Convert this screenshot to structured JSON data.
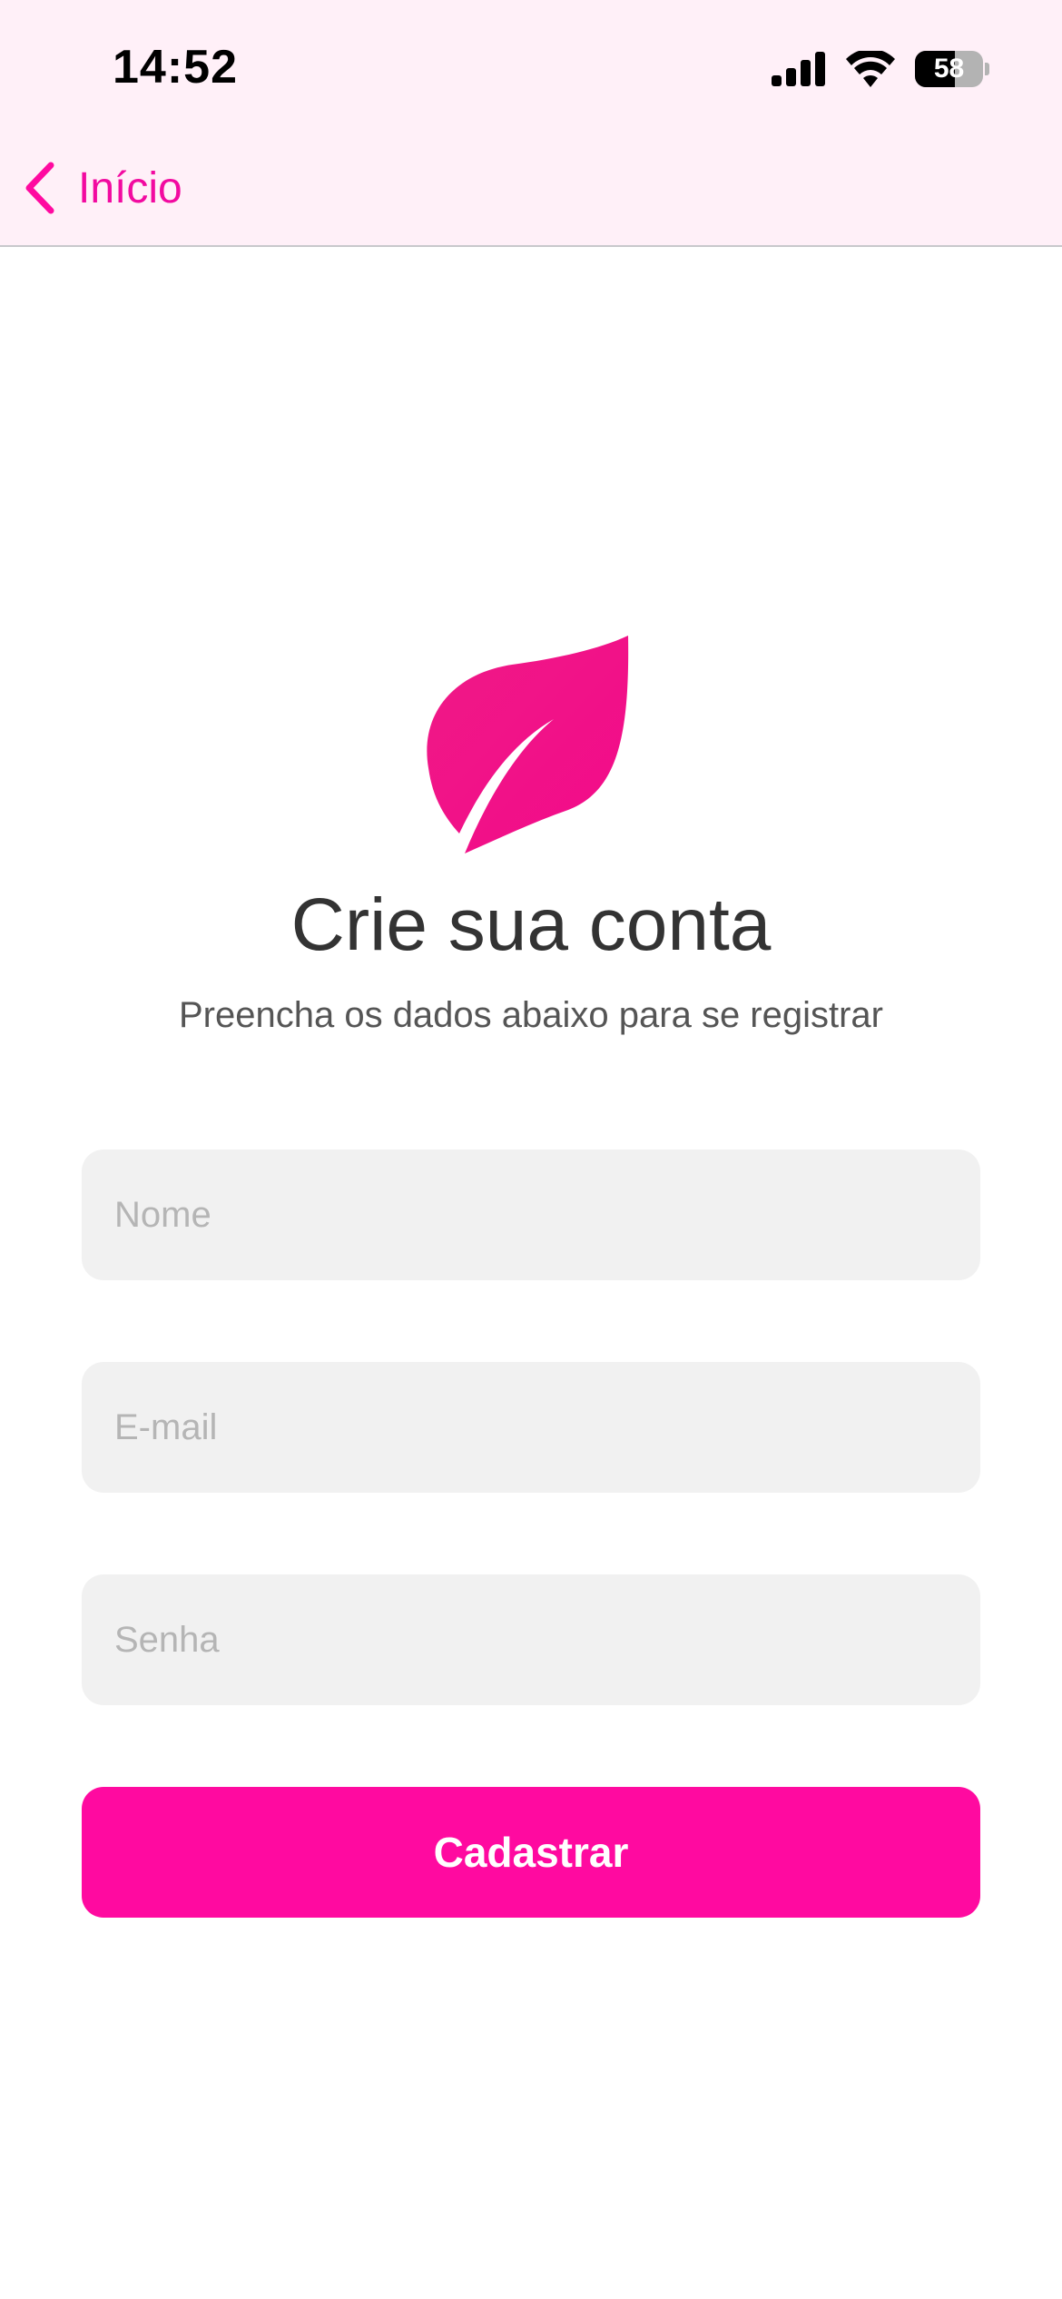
{
  "status_bar": {
    "time": "14:52",
    "battery_level": "58",
    "icons": [
      "signal-icon",
      "wifi-icon",
      "battery-icon"
    ]
  },
  "nav": {
    "back_label": "Início",
    "back_icon": "chevron-left-icon"
  },
  "header": {
    "logo_icon": "leaf-icon",
    "title": "Crie sua conta",
    "subtitle": "Preencha os dados abaixo para se registrar"
  },
  "form": {
    "name_placeholder": "Nome",
    "name_value": "",
    "email_placeholder": "E-mail",
    "email_value": "",
    "password_placeholder": "Senha",
    "password_value": "",
    "submit_label": "Cadastrar"
  },
  "colors": {
    "accent": "#ff0aa0",
    "top_bar_background": "#fff0f8",
    "field_background": "#f1f1f1",
    "title_text": "#333333"
  }
}
